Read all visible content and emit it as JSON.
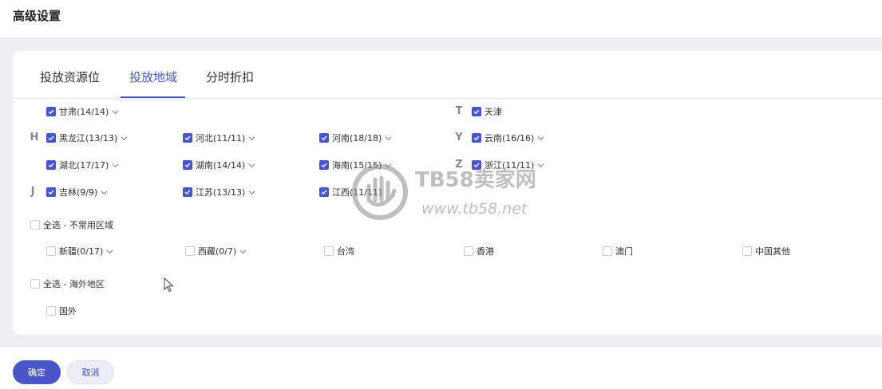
{
  "page": {
    "title": "高级设置"
  },
  "tabs": [
    {
      "label": "投放资源位",
      "active": false
    },
    {
      "label": "投放地域",
      "active": true
    },
    {
      "label": "分时折扣",
      "active": false
    }
  ],
  "letters": {
    "T": "T",
    "H": "H",
    "Y": "Y",
    "Z": "Z",
    "J": "J"
  },
  "regions": {
    "gansu": "甘肃(14/14)",
    "tianjin": "天津",
    "heilongjiang": "黑龙江(13/13)",
    "hebei": "河北(11/11)",
    "henan": "河南(18/18)",
    "yunnan": "云南(16/16)",
    "hubei": "湖北(17/17)",
    "hunan": "湖南(14/14)",
    "hainan": "海南(15/15)",
    "zhejiang": "浙江(11/11)",
    "jilin": "吉林(9/9)",
    "jiangsu": "江苏(13/13)",
    "jiangxi": "江西(11/11)"
  },
  "uncommon": {
    "select_all": "全选 - 不常用区域",
    "xinjiang": "新疆(0/17)",
    "xizang": "西藏(0/7)",
    "taiwan": "台湾",
    "hongkong": "香港",
    "macau": "澳门",
    "china_other": "中国其他"
  },
  "overseas": {
    "select_all": "全选 - 海外地区",
    "foreign": "国外"
  },
  "footer": {
    "ok_label": "确定",
    "cancel_label": "取消"
  },
  "watermark": {
    "title": "TB58卖家网",
    "url": "www.tb58.net"
  },
  "colors": {
    "accent": "#4a55c6",
    "background": "#eeeff3"
  }
}
